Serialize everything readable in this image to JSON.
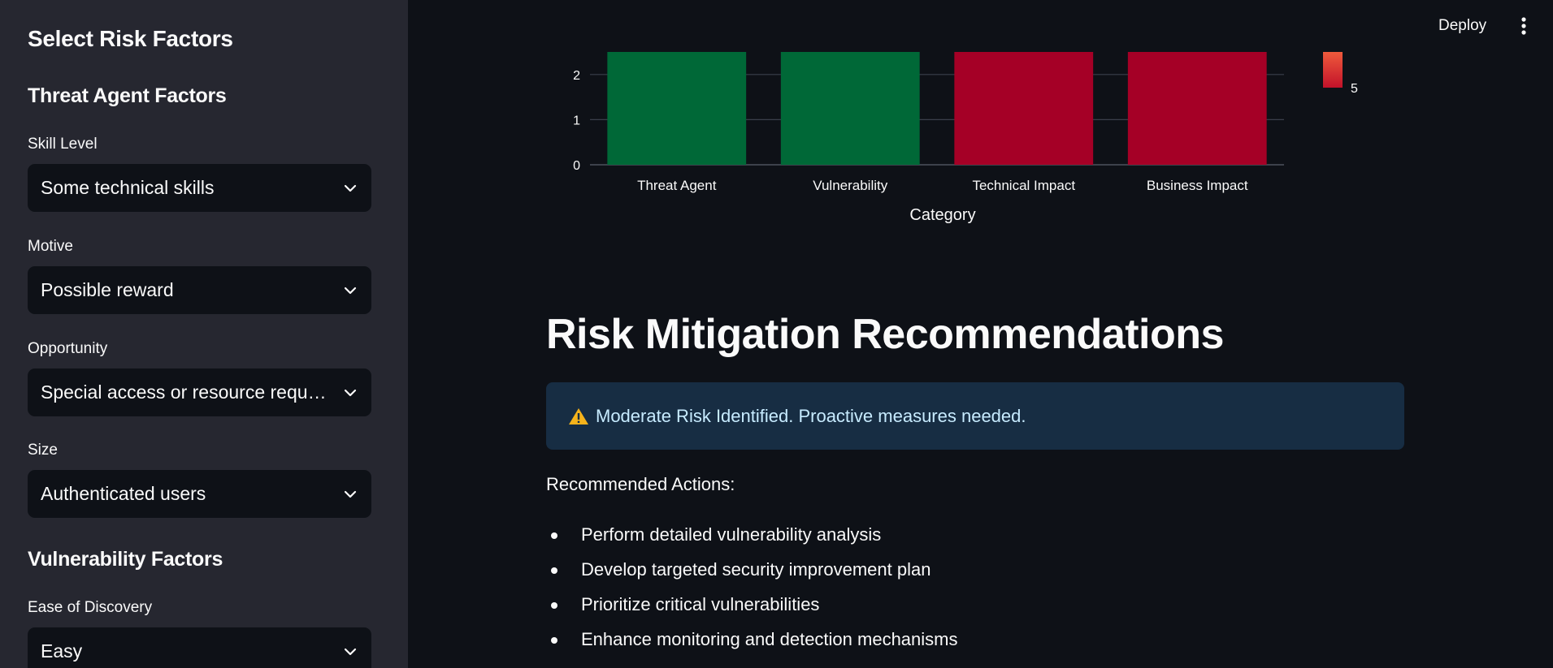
{
  "sidebar": {
    "title": "Select Risk Factors",
    "threat_section": "Threat Agent Factors",
    "vuln_section": "Vulnerability Factors",
    "fields": [
      {
        "label": "Skill Level",
        "value": "Some technical skills"
      },
      {
        "label": "Motive",
        "value": "Possible reward"
      },
      {
        "label": "Opportunity",
        "value": "Special access or resource required"
      },
      {
        "label": "Size",
        "value": "Authenticated users"
      },
      {
        "label": "Ease of Discovery",
        "value": "Easy"
      }
    ]
  },
  "header": {
    "deploy_label": "Deploy",
    "menu_icon": "vertical-dots-icon"
  },
  "chart_data": {
    "type": "bar",
    "xlabel": "Category",
    "ylabel": "",
    "categories": [
      "Threat Agent",
      "Vulnerability",
      "Technical Impact",
      "Business Impact"
    ],
    "values": [
      2.5,
      2.5,
      2.5,
      2.5
    ],
    "yticks": [
      0,
      1,
      2
    ],
    "ylim": [
      0,
      2.5
    ],
    "bar_colors": [
      "#006837",
      "#006837",
      "#a50026",
      "#a50026"
    ],
    "colorbar": {
      "visible_tick": "5",
      "colors": [
        "#ef5a3c",
        "#c2122a"
      ]
    },
    "grid": true
  },
  "main": {
    "title": "Risk Mitigation Recommendations",
    "alert": {
      "icon": "warning-icon",
      "text": "Moderate Risk Identified. Proactive measures needed.",
      "accent": "#f6b31b"
    },
    "recommended_label": "Recommended Actions:",
    "actions": [
      "Perform detailed vulnerability analysis",
      "Develop targeted security improvement plan",
      "Prioritize critical vulnerabilities",
      "Enhance monitoring and detection mechanisms"
    ]
  }
}
